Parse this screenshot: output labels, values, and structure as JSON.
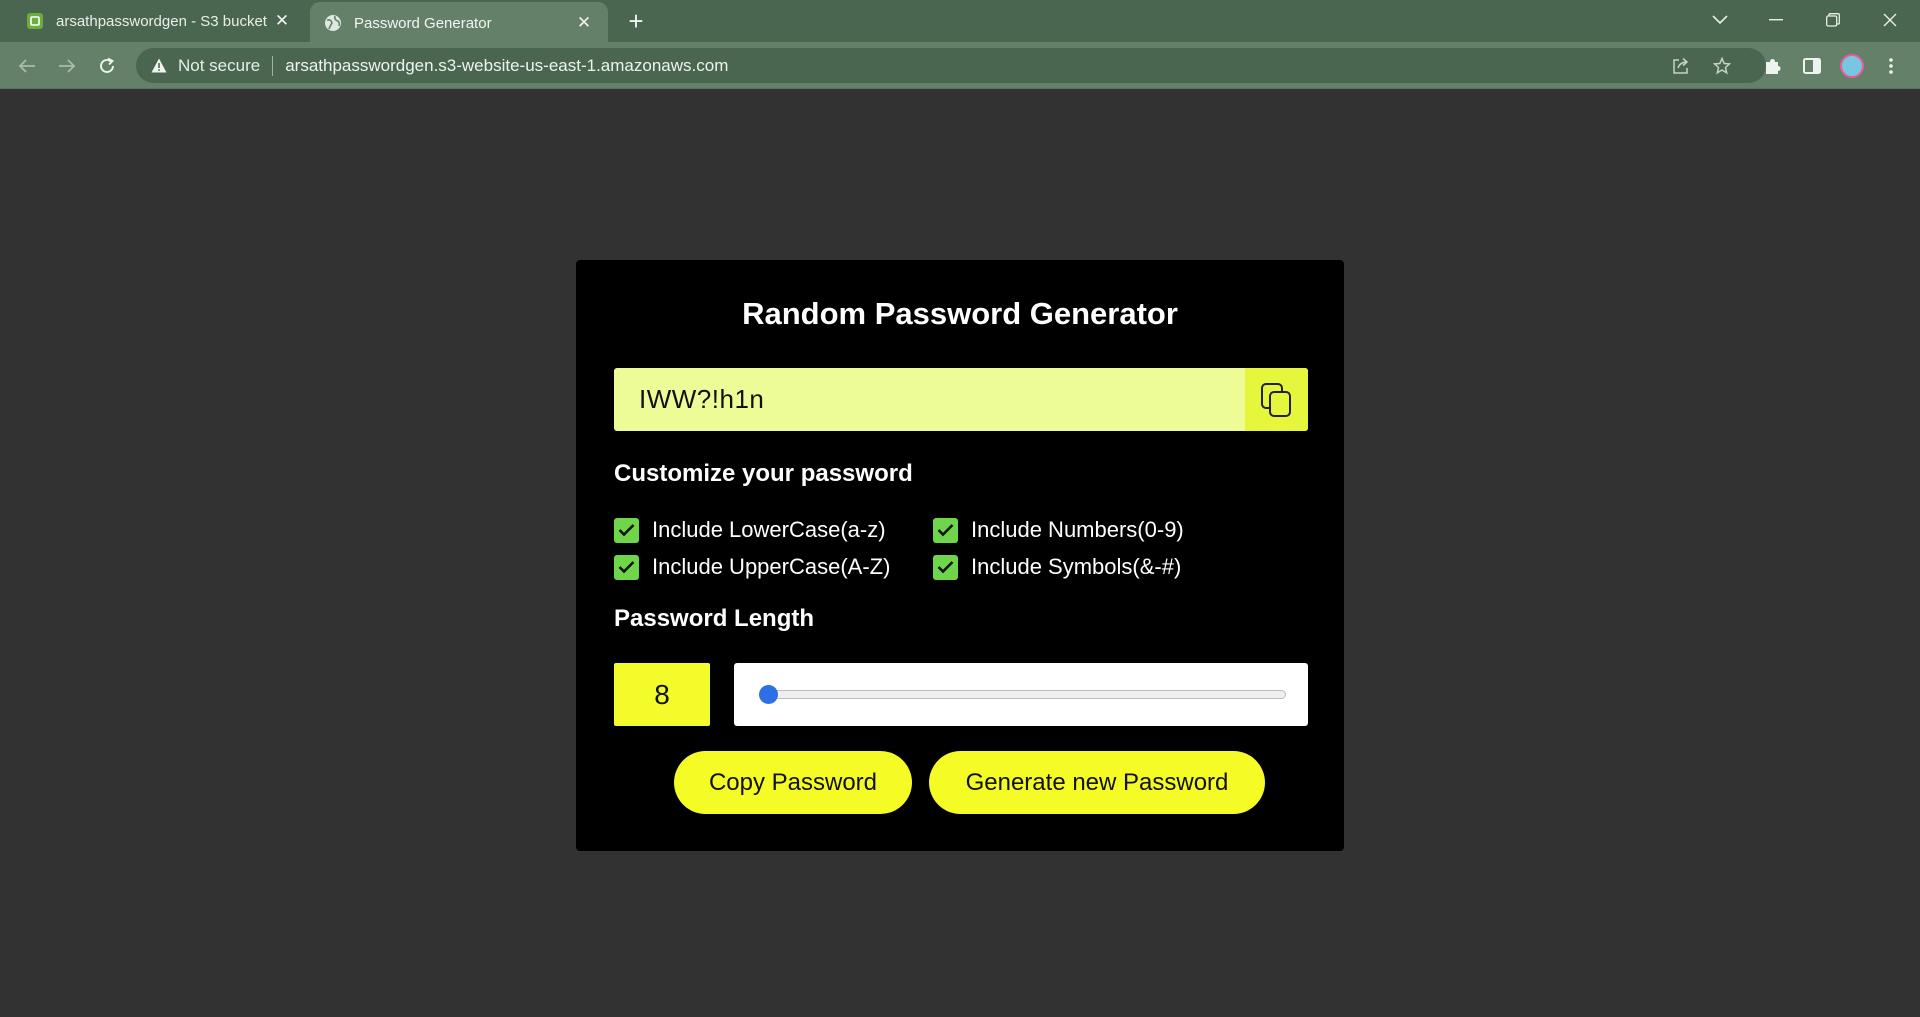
{
  "browser": {
    "tabs": [
      {
        "title": "arsathpasswordgen - S3 bucket",
        "active": false
      },
      {
        "title": "Password Generator",
        "active": true
      }
    ],
    "security_label": "Not secure",
    "url": "arsathpasswordgen.s3-website-us-east-1.amazonaws.com",
    "close_glyph": "✕",
    "newtab_glyph": "+"
  },
  "app": {
    "title": "Random Password Generator",
    "password": "IWW?!h1n",
    "customize_heading": "Customize your password",
    "options": [
      {
        "label": "Include LowerCase(a-z)",
        "checked": true
      },
      {
        "label": "Include Numbers(0-9)",
        "checked": true
      },
      {
        "label": "Include UpperCase(A-Z)",
        "checked": true
      },
      {
        "label": "Include Symbols(&-#)",
        "checked": true
      }
    ],
    "length_heading": "Password Length",
    "length": "8",
    "slider_fraction": 0.0,
    "copy_button": "Copy Password",
    "generate_button": "Generate new Password"
  },
  "colors": {
    "accent_yellow": "#f5fb25",
    "password_bg": "#eefc98",
    "checkbox_green": "#6fd64b",
    "slider_thumb": "#2f6fe6",
    "page_bg": "#333233",
    "card_bg": "#000000"
  }
}
